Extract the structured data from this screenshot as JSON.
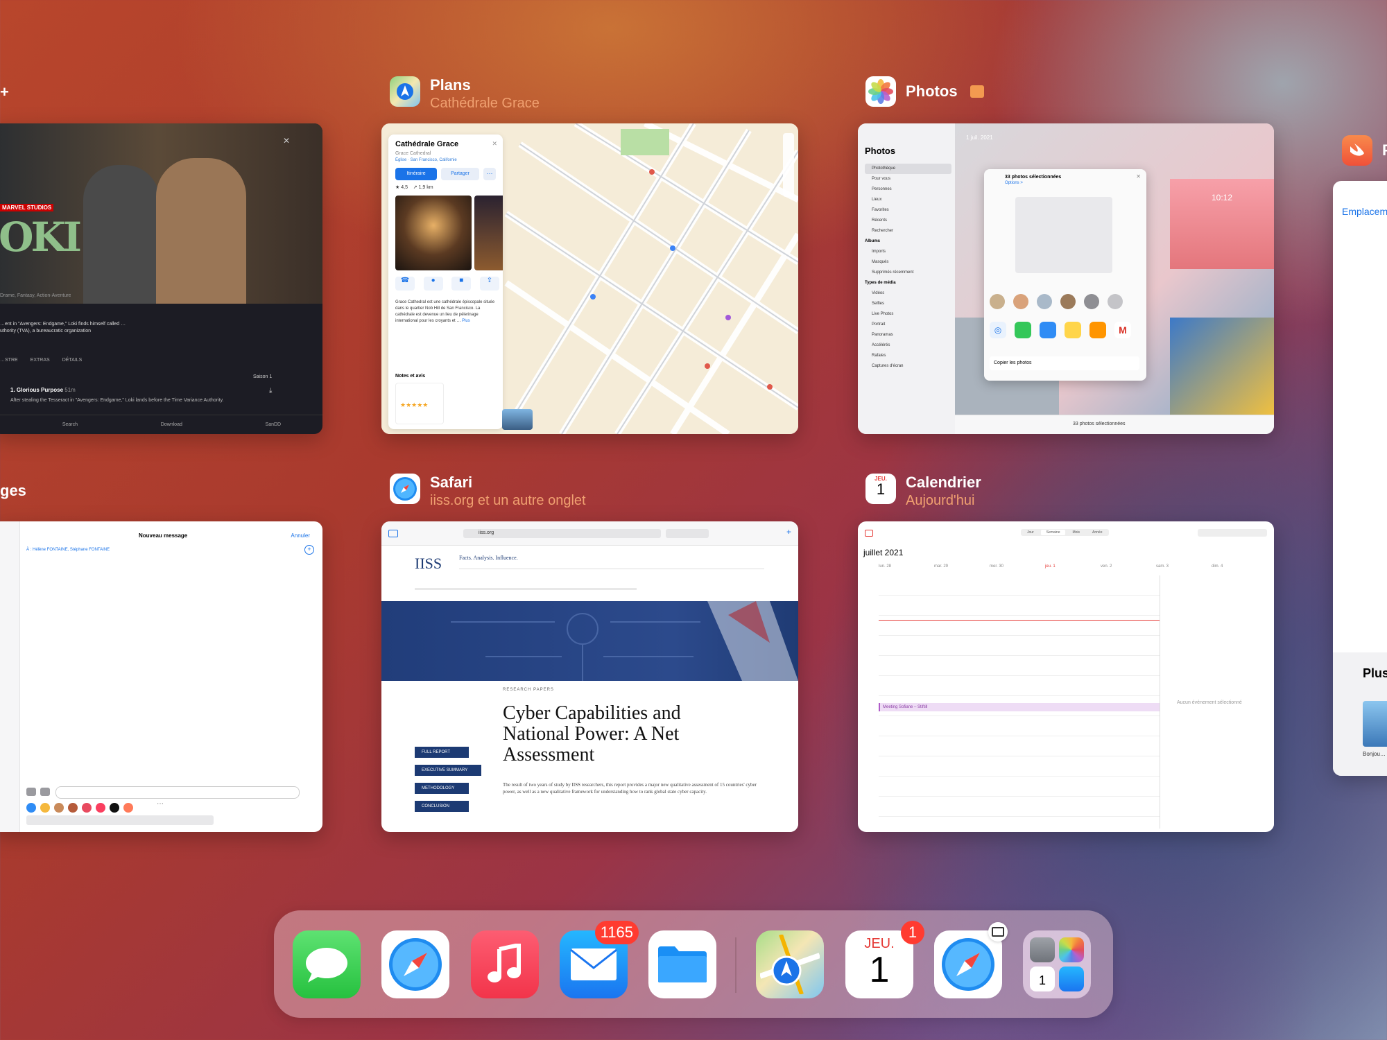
{
  "apps": {
    "tv": {
      "title_partial": "+",
      "brand": "MARVEL STUDIOS",
      "logo": "OKI",
      "genre": "Drame, Fantasy, Action-Aventure",
      "synopsis": "…ent in \"Avengers: Endgame,\" Loki finds himself called …uthority (TVA), a bureaucratic organization",
      "tabs": [
        "…STRE",
        "EXTRAS",
        "DÉTAILS"
      ],
      "season": "Saison 1",
      "episode_title": "1. Glorious Purpose",
      "episode_dur": "51m",
      "episode_desc": "After stealing the Tesseract in \"Avengers: Endgame,\" Loki lands before the Time Variance Authority.",
      "bottom": [
        "Search",
        "Download",
        "SanDD"
      ]
    },
    "plans": {
      "name": "Plans",
      "subtitle": "Cathédrale Grace",
      "place": "Cathédrale Grace",
      "place_type": "Grace Cathedral",
      "place_loc": "Église · San Francisco, Californie",
      "btn_route": "Itinéraire",
      "btn_share": "Partager",
      "desc": "Grace Cathedral est une cathédrale épiscopale située dans le quartier Nob Hill de San Francisco. La cathédrale est devenue un lieu de pèlerinage international pour les croyants et …",
      "more": "Plus",
      "reviews_label": "Notes et avis",
      "rating": "4,5",
      "dist": "1,9 km"
    },
    "photos": {
      "name": "Photos",
      "sidebar_title": "Photos",
      "date": "1 juil. 2021",
      "sidebar": [
        "Photothèque",
        "Pour vous",
        "Personnes",
        "Lieux",
        "Favorites",
        "Récents",
        "Rechercher",
        "Albums",
        "Imports",
        "Masqués",
        "Supprimés récemment",
        "Types de média",
        "Vidéos",
        "Selfies",
        "Live Photos",
        "Portrait",
        "Panoramas",
        "Accélérés",
        "Rafales",
        "Captures d'écran"
      ],
      "share_title": "33 photos sélectionnées",
      "share_sub": "Options >",
      "copy": "Copier les photos",
      "footer": "33 photos sélectionnées",
      "lock_time": "10:12"
    },
    "messages": {
      "title_partial": "ges",
      "new_title": "Nouveau message",
      "cancel": "Annuler",
      "to": "À : Hélène FONTAINE, Stéphane FONTAINE"
    },
    "safari": {
      "name": "Safari",
      "subtitle": "iiss.org et un autre onglet",
      "url": "iiss.org",
      "logo": "IISS",
      "tagline": "Facts. Analysis. Influence.",
      "kicker": "RESEARCH PAPERS",
      "headline": "Cyber Capabilities and National Power: A Net Assessment",
      "buttons": [
        "FULL REPORT",
        "EXECUTIVE SUMMARY",
        "METHODOLOGY",
        "CONCLUSION"
      ],
      "body": "The result of two years of study by IISS researchers, this report provides a major new qualitative assessment of 15 countries' cyber power, as well as a new qualitative framework for understanding how to rank global state cyber capacity."
    },
    "calendar": {
      "name": "Calendrier",
      "subtitle": "Aujourd'hui",
      "month": "juillet 2021",
      "days": [
        "lun. 28",
        "mar. 29",
        "mer. 30",
        "jeu. 1",
        "ven. 2",
        "sam. 3",
        "dim. 4"
      ],
      "views": [
        "Jour",
        "Semaine",
        "Mois",
        "Année"
      ],
      "event": "Meeting Sofiane – Stiftill",
      "no_event": "Aucun événement sélectionné",
      "icon_day": "JEU.",
      "icon_num": "1"
    },
    "swift": {
      "name_partial": "P",
      "link": "Emplacem…",
      "more": "Plus",
      "caption": "Bonjou…"
    }
  },
  "dock": {
    "apps": [
      {
        "label": "Messages",
        "badge": ""
      },
      {
        "label": "Safari",
        "badge": ""
      },
      {
        "label": "Musique",
        "badge": ""
      },
      {
        "label": "Mail",
        "badge": "1165"
      },
      {
        "label": "Fichiers",
        "badge": ""
      },
      {
        "label": "Plans",
        "badge": ""
      },
      {
        "label": "Calendrier",
        "badge": "1",
        "day": "JEU.",
        "num": "1"
      },
      {
        "label": "Safari",
        "badge": ""
      },
      {
        "label": "Bibliothèque d'apps",
        "badge": ""
      }
    ]
  },
  "colors": {
    "accent": "#007aff",
    "orange_sub": "#f0a070",
    "badge": "#ff3b30"
  }
}
